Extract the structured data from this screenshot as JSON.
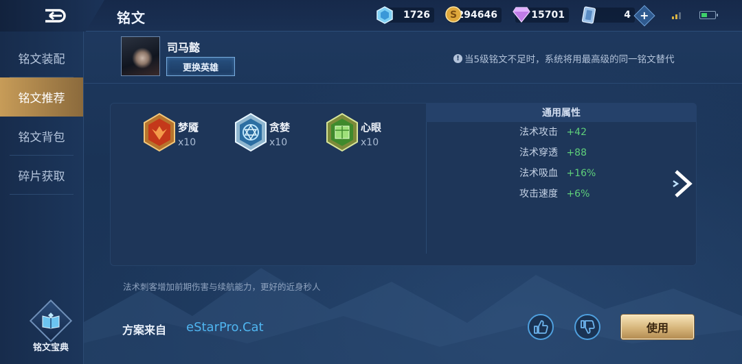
{
  "header": {
    "title": "铭文",
    "resources": [
      {
        "icon": "crystal-icon",
        "value": "1726"
      },
      {
        "icon": "gold-coin-icon",
        "value": "294646"
      },
      {
        "icon": "diamond-icon",
        "value": "15701"
      },
      {
        "icon": "voucher-icon",
        "value": "4"
      }
    ]
  },
  "sidebar": {
    "items": [
      {
        "label": "铭文装配",
        "active": false
      },
      {
        "label": "铭文推荐",
        "active": true
      },
      {
        "label": "铭文背包",
        "active": false
      },
      {
        "label": "碎片获取",
        "active": false
      }
    ],
    "codex_label": "铭文宝典"
  },
  "hero": {
    "name": "司马懿",
    "change_label": "更换英雄"
  },
  "notice": "当5级铭文不足时，系统将用最高级的同一铭文替代",
  "runes": [
    {
      "name": "梦魇",
      "count": "x10",
      "color": "#d7441f"
    },
    {
      "name": "贪婪",
      "count": "x10",
      "color": "#5bb8e8"
    },
    {
      "name": "心眼",
      "count": "x10",
      "color": "#7cc24a"
    }
  ],
  "attributes": {
    "title": "通用属性",
    "rows": [
      {
        "name": "法术攻击",
        "value": "+42"
      },
      {
        "name": "法术穿透",
        "value": "+88"
      },
      {
        "name": "法术吸血",
        "value": "+16%"
      },
      {
        "name": "攻击速度",
        "value": "+6%"
      }
    ]
  },
  "description": "法术刺客增加前期伤害与续航能力，更好的近身秒人",
  "footer": {
    "source_label": "方案来自",
    "source_name": "eStarPro.Cat",
    "use_label": "使用"
  }
}
